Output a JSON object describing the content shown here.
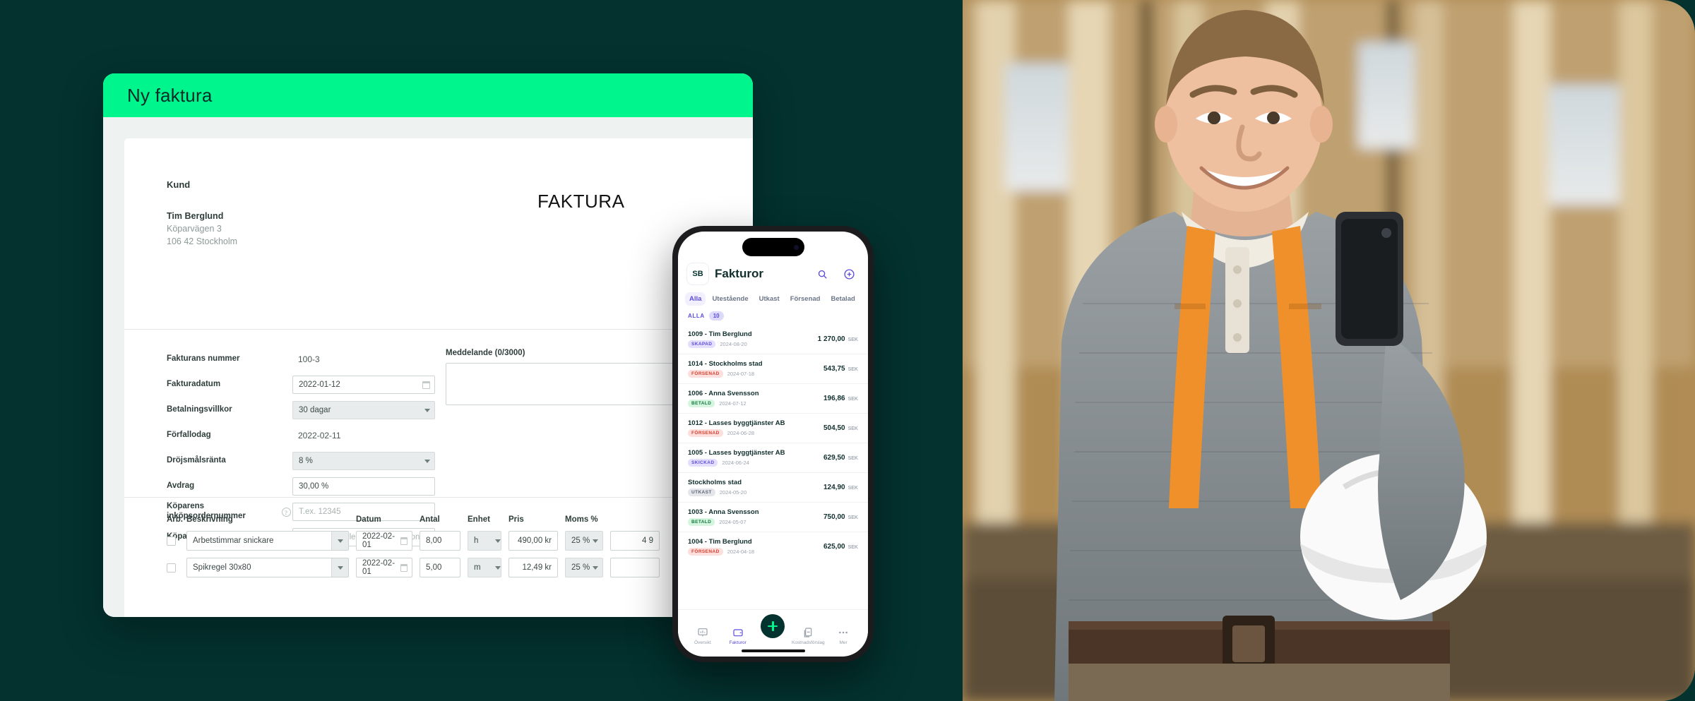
{
  "theme": {
    "bg_teal": "#03322f",
    "accent_green": "#00f58c",
    "purple": "#5b4cdb",
    "dark_green": "#04322f"
  },
  "desktop": {
    "header_title": "Ny faktura",
    "document_title": "FAKTURA",
    "customer": {
      "section_label": "Kund",
      "name": "Tim Berglund",
      "street": "Köparvägen 3",
      "city": "106 42 Stockholm"
    },
    "fields": [
      {
        "label": "Fakturans nummer",
        "value": "100-3",
        "type": "plain"
      },
      {
        "label": "Fakturadatum",
        "value": "2022-01-12",
        "type": "date"
      },
      {
        "label": "Betalningsvillkor",
        "value": "30 dagar",
        "type": "select"
      },
      {
        "label": "Förfallodag",
        "value": "2022-02-11",
        "type": "plain"
      },
      {
        "label": "Dröjsmålsränta",
        "value": "8 %",
        "type": "select"
      },
      {
        "label": "Avdrag",
        "value": "30,00 %",
        "type": "input"
      },
      {
        "label": "Köparens inköpsordernummer",
        "value": "",
        "placeholder": "T.ex. 12345",
        "type": "input",
        "help": true
      },
      {
        "label": "Köparens referens",
        "value": "",
        "placeholder": "T.ex. 12345 eller Anna Andersson",
        "type": "input",
        "help": true
      }
    ],
    "message": {
      "label": "Meddelande (0/3000)",
      "value": "",
      "max": 3000,
      "used": 0
    },
    "items_table": {
      "columns": [
        "Arb.",
        "Beskrivning",
        "Datum",
        "Antal",
        "Enhet",
        "Pris",
        "Moms %",
        ""
      ],
      "rows": [
        {
          "checked": false,
          "description": "Arbetstimmar snickare",
          "date": "2022-02-01",
          "quantity": "8,00",
          "unit": "h",
          "price": "490,00 kr",
          "vat": "25 %",
          "total": "4 9"
        },
        {
          "checked": false,
          "description": "Spikregel 30x80",
          "date": "2022-02-01",
          "quantity": "5,00",
          "unit": "m",
          "price": "12,49 kr",
          "vat": "25 %",
          "total": ""
        }
      ]
    }
  },
  "phone": {
    "avatar_initials": "SB",
    "title": "Fakturor",
    "search_icon": "search-icon",
    "add_icon": "plus-circle-icon",
    "tabs": [
      {
        "label": "Alla",
        "active": true
      },
      {
        "label": "Utestående",
        "active": false
      },
      {
        "label": "Utkast",
        "active": false
      },
      {
        "label": "Försenad",
        "active": false
      },
      {
        "label": "Betalad",
        "active": false
      }
    ],
    "list_header": {
      "label": "ALLA",
      "count": "10"
    },
    "currency": "SEK",
    "invoices": [
      {
        "name": "1009 - Tim Berglund",
        "status": "SKAPAD",
        "status_class": "b-skapad",
        "date": "2024-08-20",
        "amount": "1 270,00"
      },
      {
        "name": "1014 - Stockholms stad",
        "status": "FÖRSENAD",
        "status_class": "b-forsenad",
        "date": "2024-07-18",
        "amount": "543,75"
      },
      {
        "name": "1006 - Anna Svensson",
        "status": "BETALD",
        "status_class": "b-betald",
        "date": "2024-07-12",
        "amount": "196,86"
      },
      {
        "name": "1012 - Lasses byggtjänster AB",
        "status": "FÖRSENAD",
        "status_class": "b-forsenad",
        "date": "2024-06-28",
        "amount": "504,50"
      },
      {
        "name": "1005 - Lasses byggtjänster AB",
        "status": "SKICKAD",
        "status_class": "b-skickad",
        "date": "2024-06-24",
        "amount": "629,50"
      },
      {
        "name": "Stockholms stad",
        "status": "UTKAST",
        "status_class": "b-utkast",
        "date": "2024-05-20",
        "amount": "124,90"
      },
      {
        "name": "1003 - Anna Svensson",
        "status": "BETALD",
        "status_class": "b-betald",
        "date": "2024-05-07",
        "amount": "750,00"
      },
      {
        "name": "1004 - Tim Berglund",
        "status": "FÖRSENAD",
        "status_class": "b-forsenad",
        "date": "2024-04-18",
        "amount": "625,00"
      }
    ],
    "bottom_nav": [
      {
        "label": "Översikt",
        "icon": "chart-icon",
        "active": false
      },
      {
        "label": "Fakturor",
        "icon": "wallet-icon",
        "active": true
      },
      {
        "label": "",
        "icon": "plus-fab-icon",
        "active": false
      },
      {
        "label": "Kostnadsförslag",
        "icon": "document-icon",
        "active": false
      },
      {
        "label": "Mer",
        "icon": "ellipsis-icon",
        "active": false
      }
    ]
  },
  "photo": {
    "alt": "Smiling construction worker in grey sweater with orange suspenders holding white hard hat at building site"
  }
}
